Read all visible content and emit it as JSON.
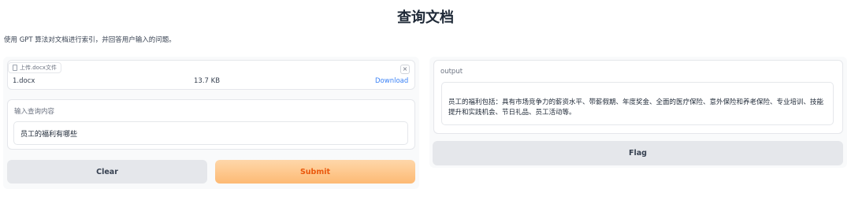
{
  "page": {
    "title": "查询文档",
    "description": "使用 GPT 算法对文档进行索引，并回答用户输入的问题。"
  },
  "upload": {
    "label": "上传.docx文件",
    "close_symbol": "×",
    "file_name": "1.docx",
    "file_size": "13.7 KB",
    "download_label": "Download"
  },
  "query": {
    "label": "输入查询内容",
    "value": "员工的福利有哪些"
  },
  "buttons": {
    "clear": "Clear",
    "submit": "Submit",
    "flag": "Flag"
  },
  "output": {
    "label": "output",
    "value": "员工的福利包括：具有市场竞争力的薪资水平、带薪假期、年度奖金、全面的医疗保险、意外保险和养老保险、专业培训、技能提升和实践机会、节日礼品、员工活动等。"
  },
  "colors": {
    "accent": "#ea580c",
    "link": "#3b82f6"
  }
}
